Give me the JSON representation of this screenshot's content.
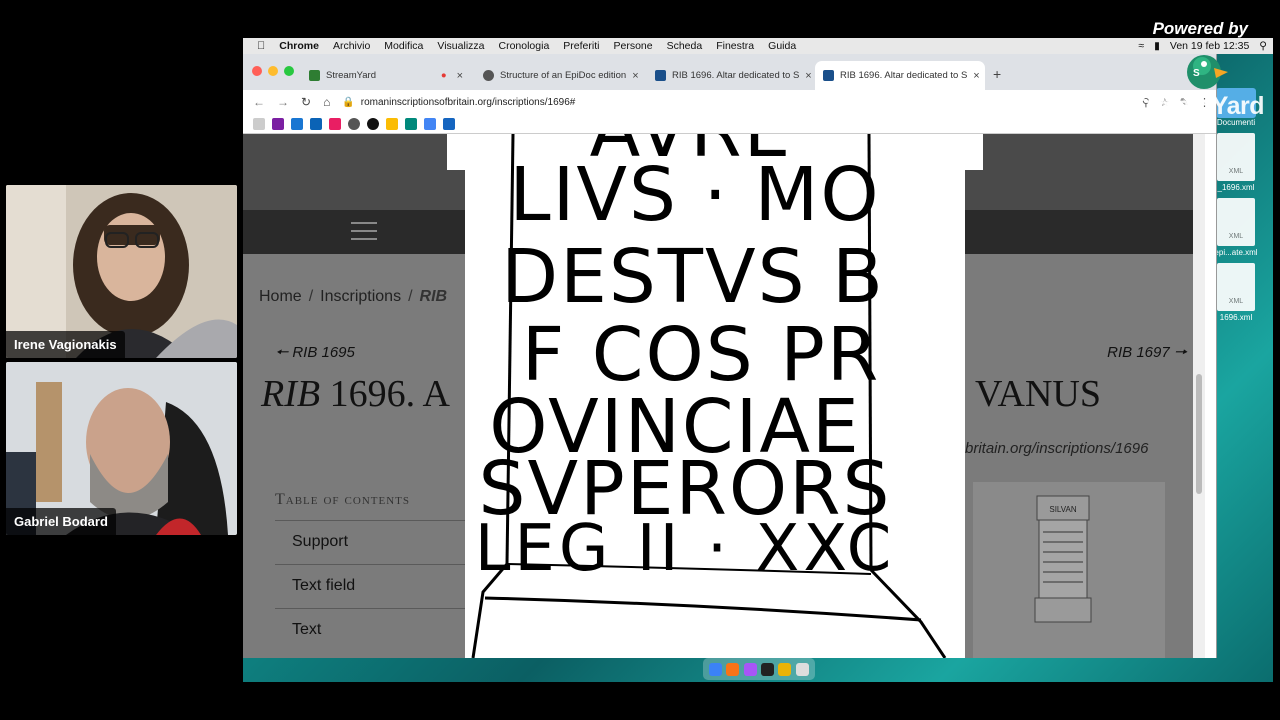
{
  "overlay": {
    "powered_by": "Powered by",
    "brand": "StreamYard"
  },
  "participants": [
    {
      "name": "Irene Vagionakis"
    },
    {
      "name": "Gabriel Bodard"
    }
  ],
  "menubar": {
    "app": "Chrome",
    "items": [
      "Archivio",
      "Modifica",
      "Visualizza",
      "Cronologia",
      "Preferiti",
      "Persone",
      "Scheda",
      "Finestra",
      "Guida"
    ],
    "clock": "Ven 19 feb 12:35"
  },
  "browser": {
    "tabs": [
      {
        "title": "StreamYard",
        "active": false,
        "color": "#2e7d32"
      },
      {
        "title": "Structure of an EpiDoc edition",
        "active": false,
        "color": "#555"
      },
      {
        "title": "RIB 1696. Altar dedicated to S",
        "active": false,
        "color": "#1a4f8a"
      },
      {
        "title": "RIB 1696. Altar dedicated to S",
        "active": true,
        "color": "#1a4f8a"
      }
    ],
    "url": "romaninscriptionsofbritain.org/inscriptions/1696#"
  },
  "page": {
    "breadcrumb": [
      "Home",
      "Inscriptions",
      "RIB"
    ],
    "prev": "RIB 1695",
    "next": "RIB 1697",
    "title_rib": "RIB",
    "title_rest": "1696. A",
    "title_end": "VANUS",
    "url_tail": "britain.org/inscriptions/1696",
    "toc_heading": "Table of contents",
    "toc": [
      "Support",
      "Text field",
      "Text"
    ],
    "thumb_caption": "SILVAN"
  },
  "inscription": {
    "lines": [
      "AVRE",
      "LIVS · MO",
      "DESTVS B",
      "F COS PR",
      "OVINCIAE",
      "SVPERORS",
      "LEG II · XXC"
    ]
  },
  "desktop": {
    "folder_label": "Documenti",
    "files": [
      {
        "type": "XML",
        "name": "_1696.xml"
      },
      {
        "type": "XML",
        "name": "epi...ate.xml"
      },
      {
        "type": "XML",
        "name": "1696.xml"
      }
    ]
  }
}
